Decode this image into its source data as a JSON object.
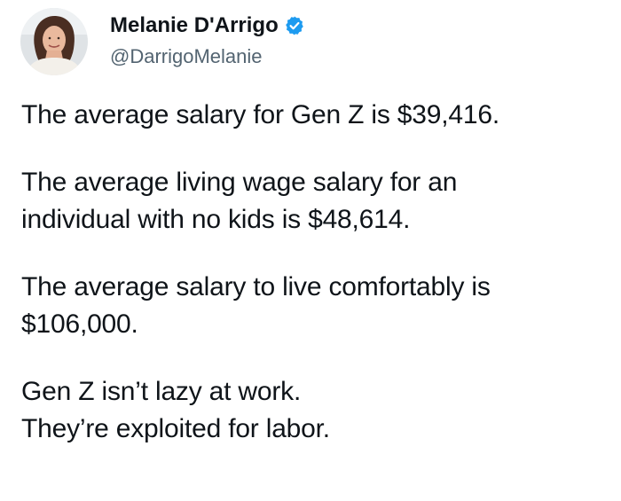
{
  "author": {
    "name": "Melanie D'Arrigo",
    "handle": "@DarrigoMelanie",
    "verified_icon": "verified-badge-icon",
    "accent_color": "#1d9bf0"
  },
  "tweet": {
    "paragraphs": [
      {
        "lines": [
          "The average salary for Gen Z is $39,416."
        ]
      },
      {
        "lines": [
          "The average living wage salary for an",
          "individual with no kids is $48,614."
        ]
      },
      {
        "lines": [
          "The average salary to live comfortably is",
          "$106,000."
        ]
      },
      {
        "lines": [
          "Gen Z isn’t lazy at work.",
          "They’re exploited for labor."
        ]
      }
    ]
  }
}
